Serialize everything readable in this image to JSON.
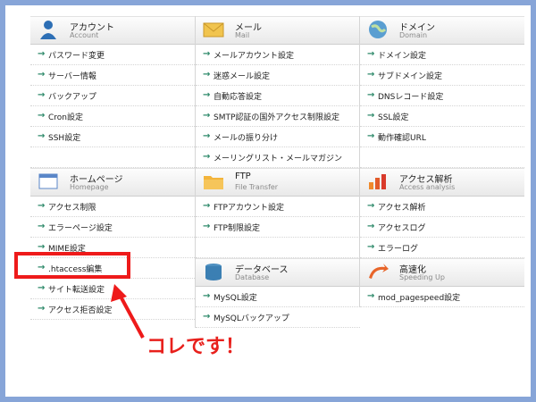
{
  "columns": [
    {
      "sections": [
        {
          "icon": "person-icon",
          "title": "アカウント",
          "subtitle": "Account",
          "items": [
            "パスワード変更",
            "サーバー情報",
            "バックアップ",
            "Cron設定",
            "SSH設定",
            ""
          ]
        },
        {
          "icon": "homepage-icon",
          "title": "ホームページ",
          "subtitle": "Homepage",
          "items": [
            "アクセス制限",
            "エラーページ設定",
            "MIME設定",
            ".htaccess編集",
            "サイト転送設定",
            "アクセス拒否設定"
          ]
        }
      ]
    },
    {
      "sections": [
        {
          "icon": "mail-envelope-icon",
          "title": "メール",
          "subtitle": "Mail",
          "items": [
            "メールアカウント設定",
            "迷惑メール設定",
            "自動応答設定",
            "SMTP認証の国外アクセス制限設定",
            "メールの振り分け",
            "メーリングリスト・メールマガジン"
          ]
        },
        {
          "icon": "folder-icon",
          "title": "FTP",
          "subtitle": "File Transfer",
          "items": [
            "FTPアカウント設定",
            "FTP制限設定",
            ""
          ]
        },
        {
          "icon": "database-icon",
          "title": "データベース",
          "subtitle": "Database",
          "items": [
            "MySQL設定",
            "MySQLバックアップ"
          ]
        }
      ]
    },
    {
      "sections": [
        {
          "icon": "globe-icon",
          "title": "ドメイン",
          "subtitle": "Domain",
          "items": [
            "ドメイン設定",
            "サブドメイン設定",
            "DNSレコード設定",
            "SSL設定",
            "動作確認URL",
            ""
          ]
        },
        {
          "icon": "chart-icon",
          "title": "アクセス解析",
          "subtitle": "Access analysis",
          "items": [
            "アクセス解析",
            "アクセスログ",
            "エラーログ"
          ]
        },
        {
          "icon": "speed-arrow-icon",
          "title": "高速化",
          "subtitle": "Speeding Up",
          "items": [
            "mod_pagespeed設定"
          ]
        }
      ]
    }
  ],
  "callout_text": "コレです！",
  "colors": {
    "highlight": "#ee1a1a",
    "frame": "#87a5d8",
    "arrow": "#2f8a6b"
  }
}
